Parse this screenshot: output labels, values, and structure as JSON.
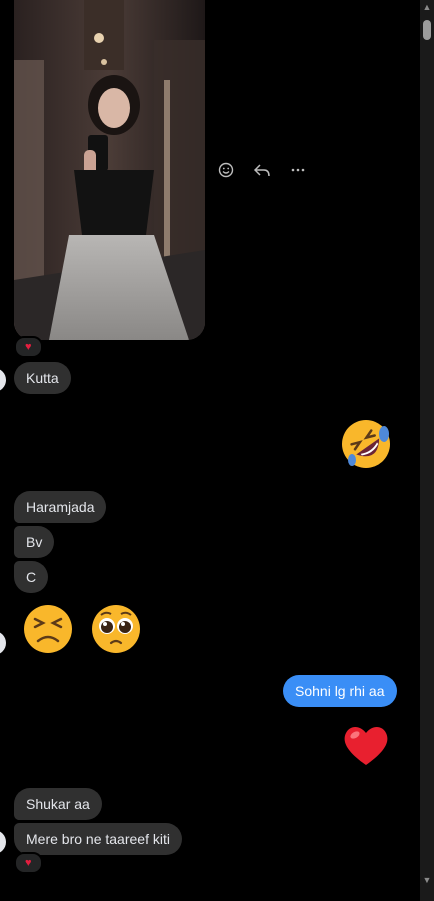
{
  "photo": {
    "alt_name": "shared-photo"
  },
  "actions": {
    "react_icon": "smile-icon",
    "reply_icon": "reply-icon",
    "more_icon": "more-icon"
  },
  "reactions": {
    "photo_reaction": "♥",
    "last_reaction": "♥"
  },
  "messages": {
    "kutta": "Kutta",
    "haramjada": "Haramjada",
    "bv": "Bv",
    "c": "C",
    "sohni": "Sohni lg rhi aa",
    "shukar": "Shukar aa",
    "mere_bro": "Mere bro ne taareef kiti"
  },
  "emojis": {
    "laughing_rolling": "rolling-on-floor-laughing-emoji",
    "tired": "tired-face-emoji",
    "pleading": "pleading-face-emoji",
    "red_heart": "red-heart-emoji"
  },
  "colors": {
    "outgoing_bubble": "#3a8ef6",
    "incoming_bubble": "#303030",
    "reaction_heart": "#e41e3f"
  }
}
